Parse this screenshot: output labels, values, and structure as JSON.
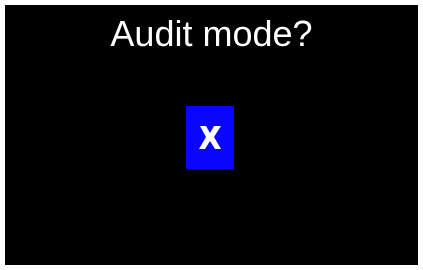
{
  "dialog": {
    "title": "Audit mode?"
  },
  "toggle": {
    "icon": "x-icon",
    "state": "off",
    "background_color": "#0a05ff",
    "icon_color": "#ffffff"
  },
  "colors": {
    "screen_background": "#000000",
    "text": "#ffffff"
  }
}
